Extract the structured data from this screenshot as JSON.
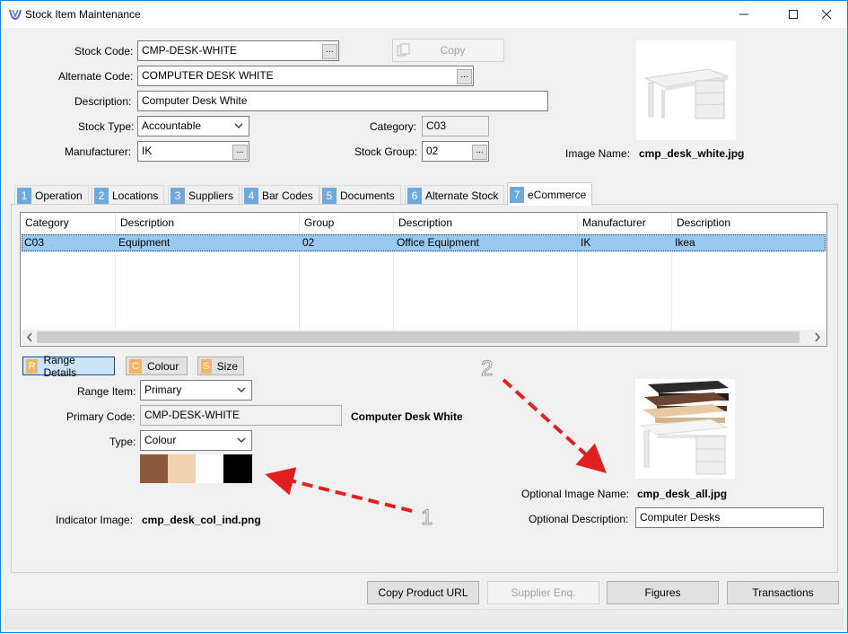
{
  "window": {
    "title": "Stock Item Maintenance"
  },
  "header": {
    "stock_code_label": "Stock Code:",
    "stock_code_value": "CMP-DESK-WHITE",
    "alternate_code_label": "Alternate Code:",
    "alternate_code_value": "COMPUTER DESK WHITE",
    "description_label": "Description:",
    "description_value": "Computer Desk White",
    "stock_type_label": "Stock Type:",
    "stock_type_value": "Accountable",
    "manufacturer_label": "Manufacturer:",
    "manufacturer_value": "IK",
    "category_label": "Category:",
    "category_value": "C03",
    "stock_group_label": "Stock Group:",
    "stock_group_value": "02",
    "copy_label": "Copy",
    "image_name_label": "Image Name:",
    "image_name_value": "cmp_desk_white.jpg",
    "ellipsis": "..."
  },
  "tabs": [
    {
      "num": "1",
      "label": "Operation"
    },
    {
      "num": "2",
      "label": "Locations"
    },
    {
      "num": "3",
      "label": "Suppliers"
    },
    {
      "num": "4",
      "label": "Bar Codes"
    },
    {
      "num": "5",
      "label": "Documents"
    },
    {
      "num": "6",
      "label": "Alternate Stock"
    },
    {
      "num": "7",
      "label": "eCommerce"
    }
  ],
  "grid": {
    "columns": [
      "Category",
      "Description",
      "Group",
      "Description",
      "Manufacturer",
      "Description"
    ],
    "rows": [
      [
        "C03",
        "Equipment",
        "02",
        "Office Equipment",
        "IK",
        "Ikea"
      ]
    ]
  },
  "options": {
    "range_details": {
      "letter": "R",
      "label": "Range Details"
    },
    "colour": {
      "letter": "C",
      "label": "Colour"
    },
    "size": {
      "letter": "S",
      "label": "Size"
    }
  },
  "range": {
    "range_item_label": "Range Item:",
    "range_item_value": "Primary",
    "primary_code_label": "Primary Code:",
    "primary_code_value": "CMP-DESK-WHITE",
    "primary_desc": "Computer Desk White",
    "type_label": "Type:",
    "type_value": "Colour",
    "indicator_image_label": "Indicator Image:",
    "indicator_image_value": "cmp_desk_col_ind.png",
    "swatch_colors": [
      "#8b5a3c",
      "#f2d2b0",
      "#ffffff",
      "#000000"
    ]
  },
  "optional": {
    "image_name_label": "Optional Image Name:",
    "image_name_value": "cmp_desk_all.jpg",
    "description_label": "Optional Description:",
    "description_value": "Computer Desks"
  },
  "annotations": {
    "one": "1",
    "two": "2",
    "arrow_color": "#e02020"
  },
  "footer": {
    "copy_product_url": "Copy Product URL",
    "supplier_enq": "Supplier Enq.",
    "figures": "Figures",
    "transactions": "Transactions"
  }
}
